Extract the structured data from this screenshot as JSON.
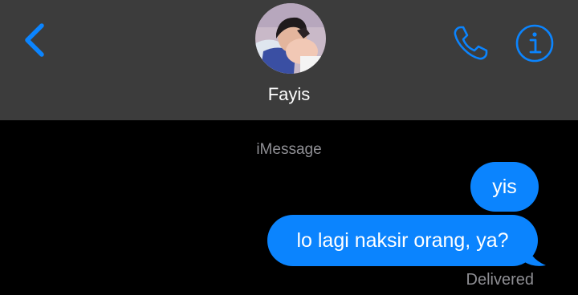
{
  "header": {
    "contact_name": "Fayis",
    "back_icon": "chevron-left-icon",
    "call_icon": "phone-icon",
    "info_icon": "info-icon",
    "accent_color": "#0b84fe",
    "background_color": "#3c3c3c"
  },
  "conversation": {
    "service_label": "iMessage",
    "messages": [
      {
        "text": "yis",
        "direction": "outgoing"
      },
      {
        "text": "lo lagi naksir orang, ya?",
        "direction": "outgoing"
      }
    ],
    "status": "Delivered",
    "bubble_color": "#0b84fe",
    "background_color": "#000000"
  }
}
